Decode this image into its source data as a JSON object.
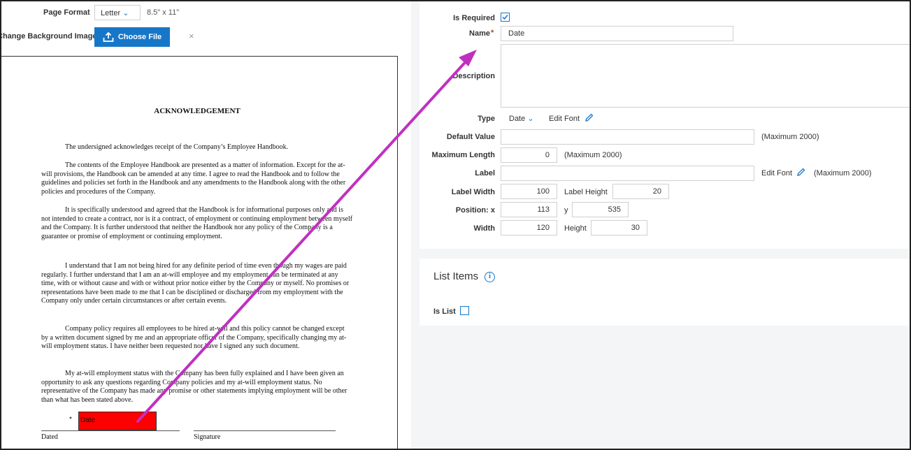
{
  "page_format": {
    "label": "Page Format",
    "value": "Letter",
    "size": "8.5\" x 11\""
  },
  "background": {
    "label": "Change Background Image",
    "button": "Choose File",
    "clear": "×"
  },
  "document": {
    "title": "ACKNOWLEDGEMENT",
    "paragraphs": [
      "The undersigned acknowledges receipt of the Company’s Employee Handbook.",
      "The contents of the Employee Handbook are presented as a matter of information. Except for the at-will provisions, the Handbook can be amended at any time. I agree to read the Handbook and to follow the guidelines and policies set forth in the Handbook and any amendments to the Handbook along with the other policies and procedures of the Company.",
      "It is specifically understood and agreed that the Handbook is for informational purposes only and is not intended to create a contract, nor is it a contract, of employment or continuing employment between myself and the Company. It is further understood that neither the Handbook nor any policy of the Company is a guarantee or promise of employment or continuing employment.",
      "I understand that I am not being hired for any definite period of time even though my wages are paid regularly. I further understand that I am an at-will employee and my employment can be terminated at any time, with or without cause and with or without prior notice either by the Company or myself. No promises or representations have been made to me that I can be disciplined or discharged from my employment with the Company only under certain circumstances or after certain events.",
      "Company policy requires all employees to be hired at-will and this policy cannot be changed except by a written document signed by me and an appropriate officer of the Company, specifically changing my at-will employment status. I have neither been requested nor have I signed any such document.",
      "My at-will employment status with the Company has been fully explained and I have been given an opportunity to ask any questions regarding Company policies and my at-will employment status. No representative of the Company has made any promise or other statements implying employment will be other than what has been stated above."
    ],
    "required_star": "*",
    "date_field": "Date",
    "dated_label": "Dated",
    "signature_label": "Signature"
  },
  "properties": {
    "is_required_label": "Is Required",
    "is_required_checked": true,
    "name_label": "Name",
    "name_required": "*",
    "name_value": "Date",
    "description_label": "Description",
    "description_value": "",
    "type_label": "Type",
    "type_value": "Date",
    "edit_font": "Edit Font",
    "default_value_label": "Default Value",
    "default_value": "",
    "max_2000": "(Maximum 2000)",
    "max_length_label": "Maximum Length",
    "max_length_value": "0",
    "label_label": "Label",
    "label_value": "",
    "label_width_label": "Label Width",
    "label_width_value": "100",
    "label_height_label": "Label Height",
    "label_height_value": "20",
    "position_label": "Position: x",
    "position_x": "113",
    "y_label": "y",
    "position_y": "535",
    "width_label": "Width",
    "width_value": "120",
    "height_label": "Height",
    "height_value": "30"
  },
  "list_items": {
    "title": "List Items",
    "info": "i",
    "is_list_label": "Is List",
    "is_list_checked": false
  },
  "colors": {
    "accent": "#1677c8",
    "highlight": "#ff0000",
    "arrow": "#c030c0"
  }
}
